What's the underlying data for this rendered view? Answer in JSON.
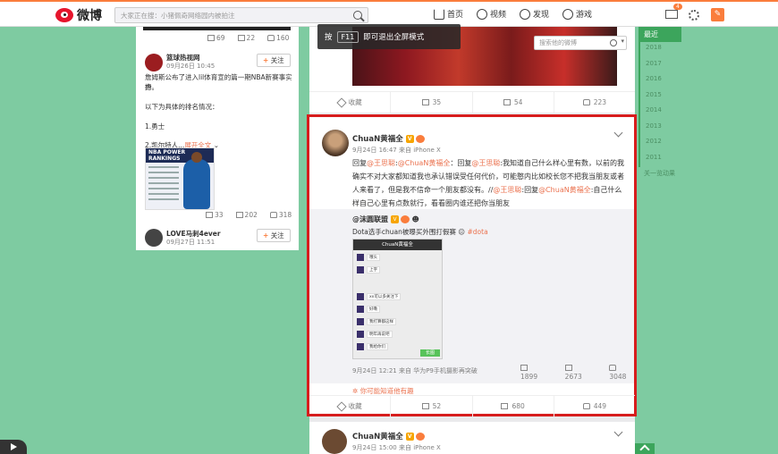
{
  "topbar": {
    "logo_text": "微博",
    "search_placeholder": "大家正在搜：小猪佩奇网络园内被拍注",
    "nav": [
      {
        "label": "首页",
        "icon": "home-icon"
      },
      {
        "label": "视频",
        "icon": "video-icon"
      },
      {
        "label": "发现",
        "icon": "discover-icon"
      },
      {
        "label": "游戏",
        "icon": "game-icon"
      }
    ],
    "mail_badge": "4"
  },
  "fullscreen_tip": {
    "prefix": "按",
    "key": "F11",
    "suffix": "即可退出全屏模式"
  },
  "inner_search_placeholder": "搜索他的微博",
  "left_column": {
    "top_stats": {
      "shares": "69",
      "comments": "22",
      "likes": "160"
    },
    "post1": {
      "author": "篮球热视网",
      "time": "09月26日 10:45",
      "follow": "关注",
      "lines": [
        "詹姆斯公布了进入lil体育宣的篇一期NBA新赛事实力",
        "榜。",
        "",
        "以下为具体的排名情况：",
        "",
        "1.勇士",
        "",
        "2.凯尔特人..."
      ],
      "expand": "展开全文",
      "image_title": "NBA POWER RANKINGS",
      "stats": {
        "shares": "33",
        "comments": "202",
        "likes": "318"
      }
    },
    "post2": {
      "author": "LOVE马刺4ever",
      "time": "09月27日 11:51",
      "follow": "关注"
    }
  },
  "prev_card_stats": {
    "fav": "收藏",
    "shares": "35",
    "comments": "54",
    "likes": "223"
  },
  "highlight_post": {
    "author": "ChuaN黄福全",
    "time": "9月24日 16:47 来自 iPhone X",
    "text_parts": [
      {
        "t": "回复",
        "m": false
      },
      {
        "t": "@王思聪",
        "m": true
      },
      {
        "t": ":",
        "m": false
      },
      {
        "t": "@ChuaN黄福全",
        "m": true
      },
      {
        "t": "：回复",
        "m": false
      },
      {
        "t": "@王思聪",
        "m": true
      },
      {
        "t": ":我知道自己什么样心里有数，以前的我确实不对大家都知道我也承认错误受任何代价，可能憨内比如校长您不把我当朋友或者人来看了，但是我不信命一个朋友都没有。//",
        "m": false
      },
      {
        "t": "@王思聪",
        "m": true
      },
      {
        "t": ":回复",
        "m": false
      },
      {
        "t": "@ChuaN黄福全",
        "m": true
      },
      {
        "t": ":自己什么样自己心里有点数就行，看看圈内谁还把你当朋友",
        "m": false
      }
    ],
    "repost": {
      "author": "@沫圆联盟",
      "text": "Dota选手chuan被曝买外围打假赛",
      "tag": "#dota",
      "phone_title": "ChuaN黄福全",
      "chat_lines": [
        "哦头",
        "上字",
        "",
        "xx可以多关注下",
        "好嘞",
        "我打算都这样",
        "明年再说吧",
        "我给你们"
      ],
      "send_label": "长图",
      "meta": "9月24日 12:21 来自 华为P9手机摄影再突破",
      "stats": {
        "shares": "1899",
        "comments": "2673",
        "likes": "3048"
      }
    },
    "maybe_know": "你可能知道他有趣",
    "stats": {
      "fav": "收藏",
      "shares": "52",
      "comments": "680",
      "likes": "449"
    }
  },
  "bottom_post": {
    "author": "ChuaN黄福全",
    "time": "9月24日 15:00 来自 iPhone X"
  },
  "right_nav": {
    "current": "最近",
    "years": [
      "2018",
      "2017",
      "2016",
      "2015",
      "2014",
      "2013",
      "2012",
      "2011"
    ],
    "more": "关一览动果"
  },
  "colors": {
    "accent": "#fa7d3c",
    "page_bg": "#7ecba1",
    "highlight_border": "#d71d1d",
    "link": "#eb7350",
    "timeline_green": "#3ca55c"
  }
}
